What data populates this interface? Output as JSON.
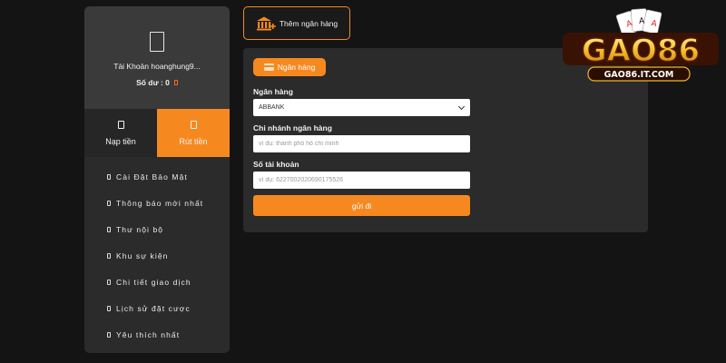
{
  "sidebar": {
    "account_label": "Tài Khoản hoanghung9...",
    "balance_label": "Số dư : 0",
    "tabs": [
      {
        "label": "Nạp tiền",
        "icon": "document-icon"
      },
      {
        "label": "Rút tiền",
        "icon": "document-icon"
      }
    ],
    "items": [
      {
        "label": "Cài Đặt Bảo Mật"
      },
      {
        "label": "Thông báo mới nhất"
      },
      {
        "label": "Thư nội bộ"
      },
      {
        "label": "Khu sự kiện"
      },
      {
        "label": "Chi tiết giao dịch"
      },
      {
        "label": "Lịch sử đặt cược"
      },
      {
        "label": "Yêu thích nhất"
      }
    ]
  },
  "header": {
    "add_bank_label": "Thêm ngân hàng"
  },
  "form": {
    "section_label": "Ngân hàng",
    "bank_label": "Ngân hàng",
    "bank_value": "ABBANK",
    "branch_label": "Chi nhánh ngân hàng",
    "branch_placeholder": "ví dụ: thành phố hồ chí minh",
    "account_label": "Số tài khoản",
    "account_placeholder": "ví dụ: 6227002020690175526",
    "submit_label": "gửi đi"
  },
  "logo": {
    "brand": "GAO86",
    "domain": "GAO86.IT.COM"
  },
  "colors": {
    "accent": "#f5891f",
    "background": "#141414",
    "panel": "#2b2b2b"
  }
}
